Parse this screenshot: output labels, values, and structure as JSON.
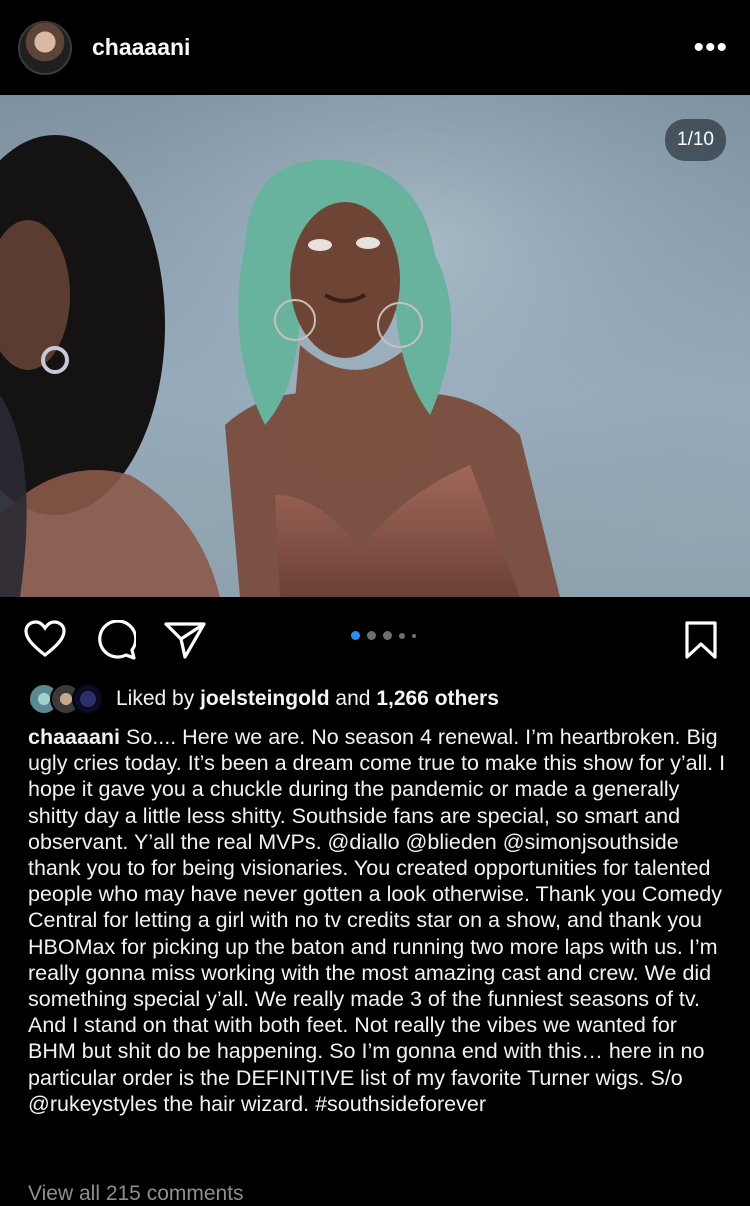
{
  "post": {
    "username": "chaaaani",
    "more_icon": "more-horizontal-icon",
    "photo_counter": "1/10",
    "carousel": {
      "total_dots": 5,
      "active_index": 0
    }
  },
  "actions": {
    "like_icon": "heart-icon",
    "comment_icon": "comment-icon",
    "share_icon": "send-icon",
    "save_icon": "bookmark-icon"
  },
  "likes": {
    "prefix": "Liked by ",
    "user": "joelsteingold",
    "middle": " and ",
    "count": "1,266 others"
  },
  "caption": {
    "username": "chaaaani",
    "text": " So.... Here we are. No season 4 renewal. I’m heartbroken. Big ugly cries today. It’s been a dream come true to make this show for y’all. I hope it gave you a chuckle during the pandemic or made a generally shitty day a little less shitty. Southside fans are special, so smart and observant. Y’all the real MVPs. @diallo @blieden @simonjsouthside thank you to for being visionaries. You created opportunities for talented people who may have never gotten a look otherwise. Thank you Comedy Central for letting a girl with no tv credits star on a show, and thank you HBOMax for picking up the baton and running two more laps with us. I’m really gonna miss working with the most amazing cast and crew. We did something special y’all. We really made 3 of the funniest seasons of tv. And I stand on that with both feet. Not really the vibes we wanted for BHM but shit do be happening. So I’m gonna end with this… here in no particular order is the DEFINITIVE list of my favorite Turner wigs. S/o @rukeystyles the hair wizard. #southsideforever"
  },
  "comments_link": "View all 215 comments",
  "colors": {
    "background": "#000000",
    "accent_dot": "#2d8cf0",
    "muted": "#8e8e8e"
  }
}
